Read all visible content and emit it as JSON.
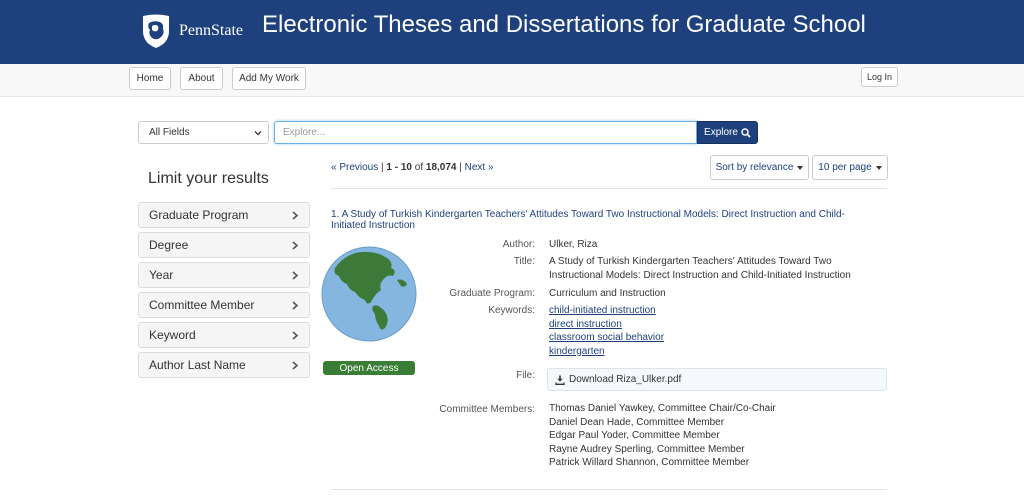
{
  "header": {
    "logo_text": "PennState",
    "title": "Electronic Theses and Dissertations for Graduate School",
    "bg_color": "#1e407c"
  },
  "nav": {
    "home": "Home",
    "about": "About",
    "add_my_work": "Add My Work",
    "login": "Log In"
  },
  "search": {
    "field_selected": "All Fields",
    "placeholder": "Explore...",
    "button_label": "Explore"
  },
  "facets": {
    "title": "Limit your results",
    "items": [
      "Graduate Program",
      "Degree",
      "Year",
      "Committee Member",
      "Keyword",
      "Author Last Name"
    ]
  },
  "results_bar": {
    "previous": "« Previous",
    "separator": " | ",
    "range": "1 - 10",
    "of": " of ",
    "total": "18,074",
    "next": "Next »",
    "sort": "Sort by relevance",
    "per_page": "10 per page"
  },
  "result": {
    "title": "1. A Study of Turkish Kindergarten Teachers' Attitudes Toward Two Instructional Models: Direct Instruction and Child-Initiated Instruction",
    "badge": "Open Access",
    "labels": {
      "author": "Author:",
      "title": "Title:",
      "program": "Graduate Program:",
      "keywords": "Keywords:",
      "file": "File:",
      "committee": "Committee Members:"
    },
    "author": "Ulker, Riza",
    "full_title": "A Study of Turkish Kindergarten Teachers' Attitudes Toward Two Instructional Models: Direct Instruction and Child-Initiated Instruction",
    "program": "Curriculum and Instruction",
    "keywords": [
      "child-initiated instruction",
      "direct instruction",
      "classroom social behavior",
      "kindergarten"
    ],
    "file_label": "Download Riza_Ulker.pdf",
    "committee": [
      "Thomas Daniel Yawkey, Committee Chair/Co-Chair",
      "Daniel Dean Hade, Committee Member",
      "Edgar Paul Yoder, Committee Member",
      "Rayne Audrey Sperling, Committee Member",
      "Patrick Willard Shannon, Committee Member"
    ],
    "badge_color": "#3a7d34"
  }
}
